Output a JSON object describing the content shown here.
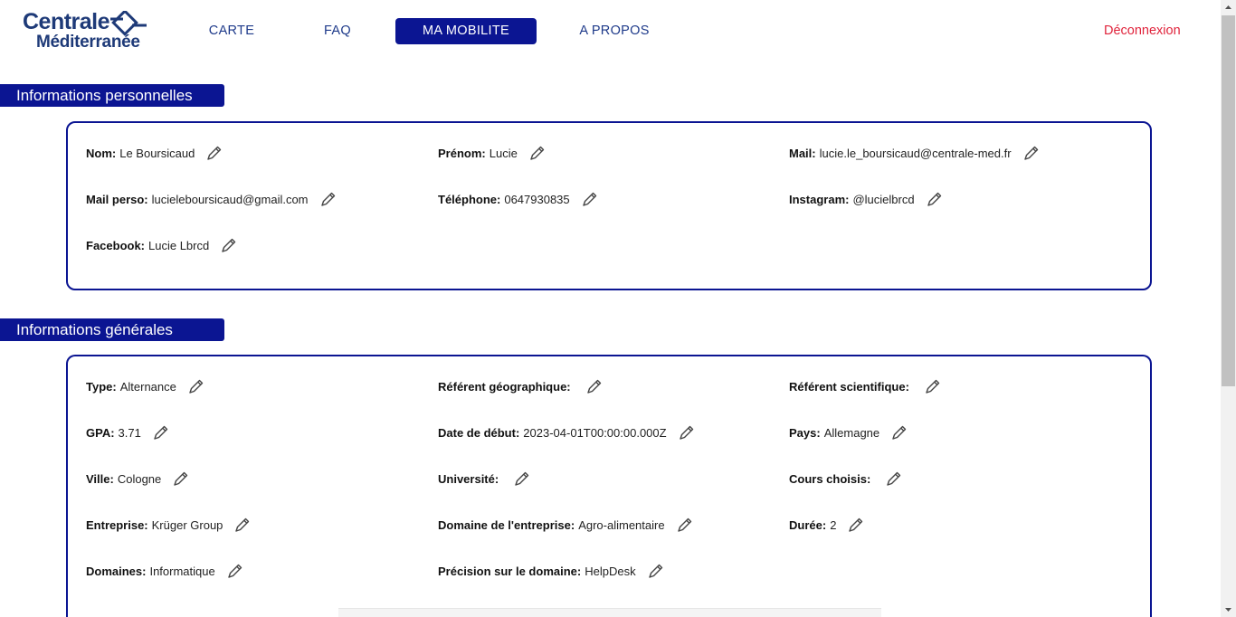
{
  "header": {
    "logo": {
      "line1": "Centrale",
      "line2": "Méditerranée"
    },
    "nav": [
      {
        "label": "CARTE"
      },
      {
        "label": "FAQ"
      },
      {
        "label": "MA MOBILITE",
        "active": true
      },
      {
        "label": "A PROPOS"
      }
    ],
    "logout": "Déconnexion"
  },
  "colors": {
    "primary": "#0b1592",
    "logout": "#e0243c",
    "logo": "#1e3a78"
  },
  "personal": {
    "title": "Informations personnelles",
    "fields": [
      {
        "label": "Nom:",
        "value": "Le Boursicaud"
      },
      {
        "label": "Prénom:",
        "value": "Lucie"
      },
      {
        "label": "Mail:",
        "value": "lucie.le_boursicaud@centrale-med.fr"
      },
      {
        "label": "Mail perso:",
        "value": "lucieleboursicaud@gmail.com"
      },
      {
        "label": "Téléphone:",
        "value": "0647930835"
      },
      {
        "label": "Instagram:",
        "value": "@lucielbrcd"
      },
      {
        "label": "Facebook:",
        "value": "Lucie Lbrcd"
      }
    ]
  },
  "general": {
    "title": "Informations générales",
    "fields": [
      {
        "label": "Type:",
        "value": "Alternance"
      },
      {
        "label": "Référent géographique:",
        "value": ""
      },
      {
        "label": "Référent scientifique:",
        "value": ""
      },
      {
        "label": "GPA:",
        "value": "3.71"
      },
      {
        "label": "Date de début:",
        "value": "2023-04-01T00:00:00.000Z"
      },
      {
        "label": "Pays:",
        "value": "Allemagne"
      },
      {
        "label": "Ville:",
        "value": "Cologne"
      },
      {
        "label": "Université:",
        "value": ""
      },
      {
        "label": "Cours choisis:",
        "value": ""
      },
      {
        "label": "Entreprise:",
        "value": "Krüger Group"
      },
      {
        "label": "Domaine de l'entreprise:",
        "value": "Agro-alimentaire"
      },
      {
        "label": "Durée:",
        "value": "2"
      },
      {
        "label": "Domaines:",
        "value": "Informatique"
      },
      {
        "label": "Précision sur le domaine:",
        "value": "HelpDesk"
      }
    ]
  },
  "icons": {
    "edit": "pencil-icon",
    "logo": "logo-mark-icon"
  }
}
